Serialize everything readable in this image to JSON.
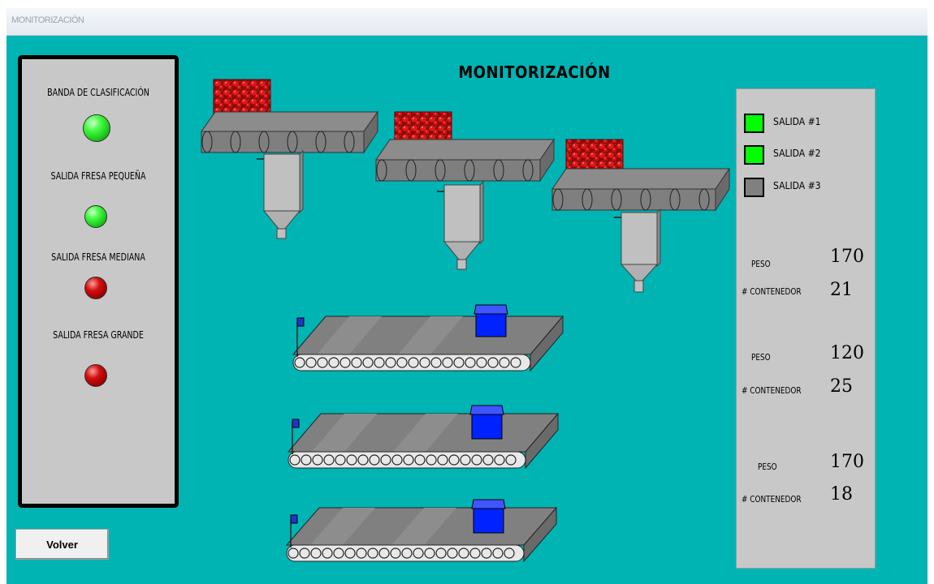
{
  "window": {
    "title": "MONITORIZACIÓN"
  },
  "main": {
    "title": "MONITORIZACIÓN"
  },
  "left_panel": {
    "indicators": [
      {
        "label": "BANDA DE CLASIFICACIÓN",
        "state": "on",
        "color": "#3cff3c"
      },
      {
        "label": "SALIDA FRESA PEQUEÑA",
        "state": "on",
        "color": "#3cff3c"
      },
      {
        "label": "SALIDA FRESA MEDIANA",
        "state": "off",
        "color": "#c40000"
      },
      {
        "label": "SALIDA FRESA GRANDE",
        "state": "off",
        "color": "#c40000"
      }
    ]
  },
  "right_panel": {
    "legend": [
      {
        "label": "SALIDA #1",
        "color": "#00ff00"
      },
      {
        "label": "SALIDA #2",
        "color": "#00ff00"
      },
      {
        "label": "SALIDA #3",
        "color": "#808080"
      }
    ],
    "outputs": [
      {
        "peso_label": "PESO",
        "peso": "170",
        "contenedor_label": "# CONTENEDOR",
        "contenedor": "21"
      },
      {
        "peso_label": "PESO",
        "peso": "120",
        "contenedor_label": "# CONTENEDOR",
        "contenedor": "25"
      },
      {
        "peso_label": "PESO",
        "peso": "170",
        "contenedor_label": "# CONTENEDOR",
        "contenedor": "18"
      }
    ]
  },
  "buttons": {
    "volver": "Volver"
  },
  "colors": {
    "background": "#00b4b4",
    "panel": "#c8c8c8",
    "container": "#0022ff",
    "belt": "#7f7f7f"
  },
  "icons": [
    "strawberry-crate-image",
    "sorting-conveyor",
    "chute-hopper",
    "container-conveyor",
    "sensor-icon",
    "container-box"
  ]
}
